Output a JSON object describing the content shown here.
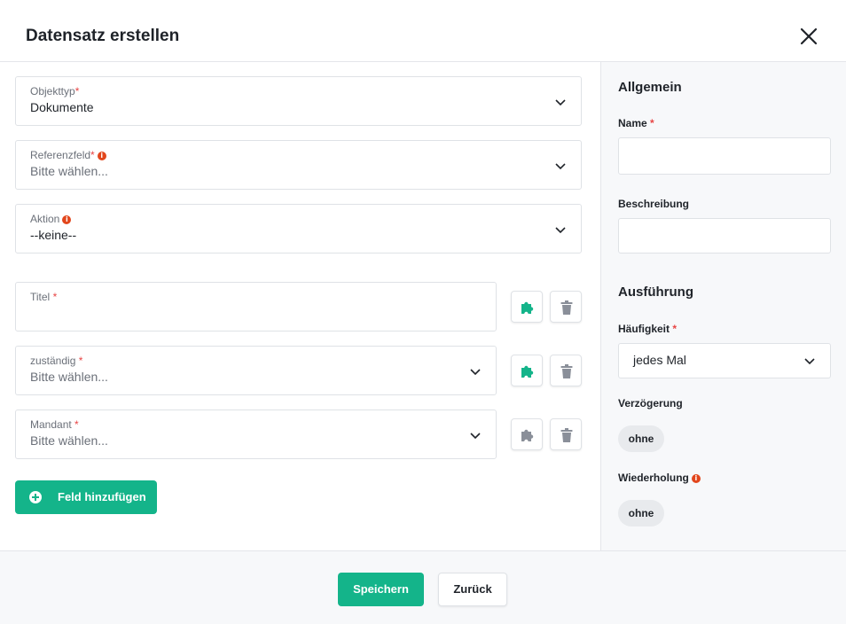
{
  "dialog": {
    "title": "Datensatz erstellen"
  },
  "icons": {
    "close": "close-icon",
    "chevron": "chevron-down-icon",
    "puzzle": "puzzle-icon",
    "trash": "trash-icon",
    "info": "info-icon",
    "plus": "plus-circle-icon"
  },
  "colors": {
    "primary": "#14b48a",
    "required": "#e84545",
    "info": "#e2461c",
    "puzzle_active": "#14b48a",
    "puzzle_inactive": "#8a8f99",
    "trash": "#8a8f99"
  },
  "form": {
    "objekttyp": {
      "label": "Objekttyp",
      "required": "*",
      "value": "Dokumente"
    },
    "referenzfeld": {
      "label": "Referenzfeld",
      "required": "*",
      "info": "i",
      "placeholder": "Bitte wählen..."
    },
    "aktion": {
      "label": "Aktion",
      "info": "i",
      "value": "--keine--"
    },
    "fields": [
      {
        "label": "Titel",
        "required": "*",
        "value": ""
      },
      {
        "label": "zuständig",
        "required": "*",
        "placeholder": "Bitte wählen..."
      },
      {
        "label": "Mandant",
        "required": "*",
        "placeholder": "Bitte wählen..."
      }
    ],
    "add_field_label": "Feld hinzufügen"
  },
  "sidebar": {
    "allgemein": "Allgemein",
    "name_label": "Name",
    "name_required": "*",
    "name_value": "",
    "beschreibung_label": "Beschreibung",
    "beschreibung_value": "",
    "ausfuehrung": "Ausführung",
    "haeufigkeit_label": "Häufigkeit",
    "haeufigkeit_required": "*",
    "haeufigkeit_value": "jedes Mal",
    "verzoegerung_label": "Verzögerung",
    "verzoegerung_value": "ohne",
    "wiederholung_label": "Wiederholung",
    "wiederholung_info": "i",
    "wiederholung_value": "ohne"
  },
  "footer": {
    "save_label": "Speichern",
    "back_label": "Zurück"
  }
}
